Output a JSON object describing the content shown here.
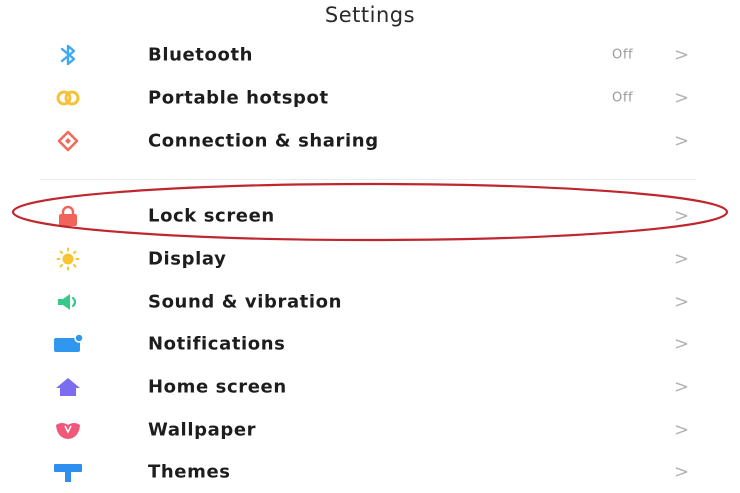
{
  "header": {
    "title": "Settings"
  },
  "items": [
    {
      "label": "Bluetooth",
      "value": "Off",
      "chevron": ">",
      "icon": "bluetooth-icon",
      "color": "#3fa9f5"
    },
    {
      "label": "Portable hotspot",
      "value": "Off",
      "chevron": ">",
      "icon": "hotspot-icon",
      "color": "#f5c23a"
    },
    {
      "label": "Connection & sharing",
      "value": "",
      "chevron": ">",
      "icon": "connection-sharing-icon",
      "color": "#ef6b5b"
    },
    {
      "label": "Lock screen",
      "value": "",
      "chevron": ">",
      "icon": "lock-icon",
      "color": "#f0645b"
    },
    {
      "label": "Display",
      "value": "",
      "chevron": ">",
      "icon": "sun-icon",
      "color": "#f7c531"
    },
    {
      "label": "Sound & vibration",
      "value": "",
      "chevron": ">",
      "icon": "speaker-icon",
      "color": "#36c98a"
    },
    {
      "label": "Notifications",
      "value": "",
      "chevron": ">",
      "icon": "notification-icon",
      "color": "#2f97ee"
    },
    {
      "label": "Home screen",
      "value": "",
      "chevron": ">",
      "icon": "home-icon",
      "color": "#7c6cf0"
    },
    {
      "label": "Wallpaper",
      "value": "",
      "chevron": ">",
      "icon": "wallpaper-icon",
      "color": "#f0587a"
    },
    {
      "label": "Themes",
      "value": "",
      "chevron": ">",
      "icon": "themes-icon",
      "color": "#2f8fee"
    }
  ],
  "annotation": {
    "highlighted_item": "Lock screen",
    "color": "#c0262d"
  }
}
